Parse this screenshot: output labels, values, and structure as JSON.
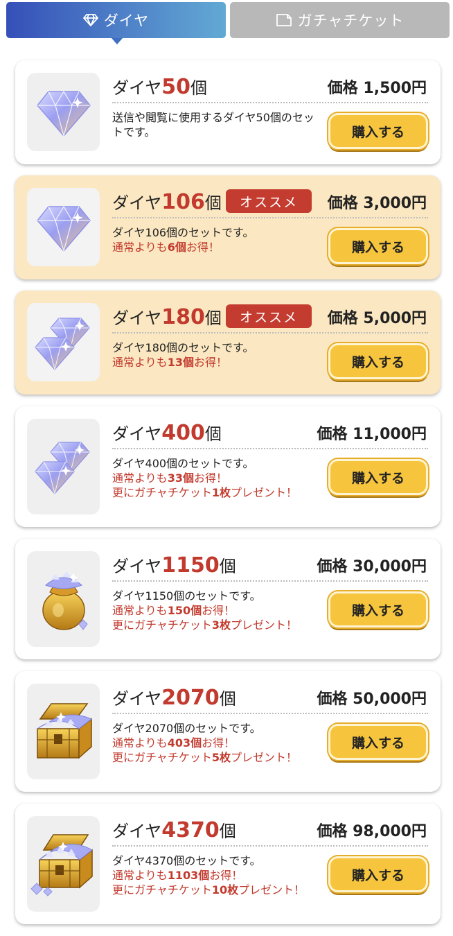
{
  "tabs": {
    "diamond_label": "ダイヤ",
    "ticket_label": "ガチャチケット"
  },
  "shop": {
    "buy_label": "購入する",
    "recommend_label": "オススメ",
    "items": [
      {
        "name_prefix": "ダイヤ",
        "amount": "50",
        "name_suffix": "個",
        "price": "価格 1,500円",
        "desc": "送信や閲覧に使用するダイヤ50個のセットです。",
        "featured": false,
        "icon": "single-diamond"
      },
      {
        "name_prefix": "ダイヤ",
        "amount": "106",
        "name_suffix": "個",
        "price": "価格 3,000円",
        "desc": "ダイヤ106個のセットです。",
        "bonus_pre": "通常よりも",
        "bonus_num": "6個",
        "bonus_post": "お得！",
        "featured": true,
        "icon": "single-diamond"
      },
      {
        "name_prefix": "ダイヤ",
        "amount": "180",
        "name_suffix": "個",
        "price": "価格 5,000円",
        "desc": "ダイヤ180個のセットです。",
        "bonus_pre": "通常よりも",
        "bonus_num": "13個",
        "bonus_post": "お得！",
        "featured": true,
        "icon": "double-diamond"
      },
      {
        "name_prefix": "ダイヤ",
        "amount": "400",
        "name_suffix": "個",
        "price": "価格 11,000円",
        "desc": "ダイヤ400個のセットです。",
        "bonus_pre": "通常よりも",
        "bonus_num": "33個",
        "bonus_post": "お得！",
        "ticket_pre": "更にガチャチケット",
        "ticket_num": "1枚",
        "ticket_post": "プレゼント！",
        "featured": false,
        "icon": "double-diamond"
      },
      {
        "name_prefix": "ダイヤ",
        "amount": "1150",
        "name_suffix": "個",
        "price": "価格 30,000円",
        "desc": "ダイヤ1150個のセットです。",
        "bonus_pre": "通常よりも",
        "bonus_num": "150個",
        "bonus_post": "お得！",
        "ticket_pre": "更にガチャチケット",
        "ticket_num": "3枚",
        "ticket_post": "プレゼント！",
        "featured": false,
        "icon": "diamond-bag"
      },
      {
        "name_prefix": "ダイヤ",
        "amount": "2070",
        "name_suffix": "個",
        "price": "価格 50,000円",
        "desc": "ダイヤ2070個のセットです。",
        "bonus_pre": "通常よりも",
        "bonus_num": "403個",
        "bonus_post": "お得！",
        "ticket_pre": "更にガチャチケット",
        "ticket_num": "5枚",
        "ticket_post": "プレゼント！",
        "featured": false,
        "icon": "treasure-chest"
      },
      {
        "name_prefix": "ダイヤ",
        "amount": "4370",
        "name_suffix": "個",
        "price": "価格 98,000円",
        "desc": "ダイヤ4370個のセットです。",
        "bonus_pre": "通常よりも",
        "bonus_num": "1103個",
        "bonus_post": "お得！",
        "ticket_pre": "更にガチャチケット",
        "ticket_num": "10枚",
        "ticket_post": "プレゼント！",
        "featured": false,
        "icon": "overflowing-treasure-chest"
      }
    ]
  }
}
